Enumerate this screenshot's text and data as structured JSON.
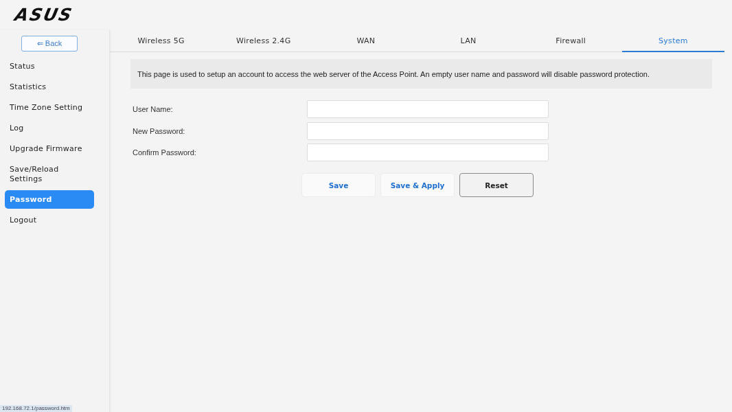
{
  "header": {
    "logo": "ASUS"
  },
  "sidebar": {
    "back_button": "⇐ Back",
    "items": [
      {
        "label": "Status",
        "selected": false
      },
      {
        "label": "Statistics",
        "selected": false
      },
      {
        "label": "Time Zone Setting",
        "selected": false
      },
      {
        "label": "Log",
        "selected": false
      },
      {
        "label": "Upgrade Firmware",
        "selected": false
      },
      {
        "label": "Save/Reload Settings",
        "selected": false
      },
      {
        "label": "Password",
        "selected": true
      },
      {
        "label": "Logout",
        "selected": false
      }
    ]
  },
  "tabs": [
    {
      "label": "Wireless 5G",
      "selected": false
    },
    {
      "label": "Wireless 2.4G",
      "selected": false
    },
    {
      "label": "WAN",
      "selected": false
    },
    {
      "label": "LAN",
      "selected": false
    },
    {
      "label": "Firewall",
      "selected": false
    },
    {
      "label": "System",
      "selected": true
    }
  ],
  "info": "This page is used to setup an account to access the web server of the Access Point. An empty user name and password will disable password protection.",
  "form": {
    "fields": [
      {
        "label": "User Name:"
      },
      {
        "label": "New Password:"
      },
      {
        "label": "Confirm Password:"
      }
    ],
    "buttons": [
      {
        "label": "Save",
        "kind": "primary"
      },
      {
        "label": "Save & Apply",
        "kind": "primary"
      },
      {
        "label": "Reset",
        "kind": "secondary"
      }
    ]
  },
  "status_bar": {
    "url": "192.168.72.1/password.htm"
  }
}
